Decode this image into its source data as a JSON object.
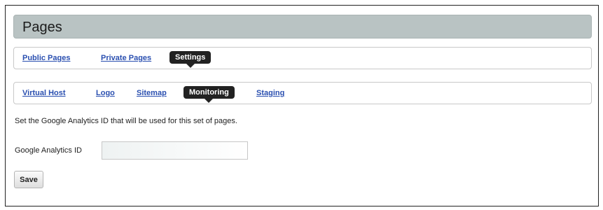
{
  "page": {
    "title": "Pages"
  },
  "primary_tabs": [
    {
      "label": "Public Pages",
      "active": false
    },
    {
      "label": "Private Pages",
      "active": false
    },
    {
      "label": "Settings",
      "active": true
    }
  ],
  "secondary_tabs": [
    {
      "label": "Virtual Host",
      "active": false
    },
    {
      "label": "Logo",
      "active": false
    },
    {
      "label": "Sitemap",
      "active": false
    },
    {
      "label": "Monitoring",
      "active": true
    },
    {
      "label": "Staging",
      "active": false
    }
  ],
  "monitoring": {
    "description": "Set the Google Analytics ID that will be used for this set of pages.",
    "field_label": "Google Analytics ID",
    "field_value": "",
    "save_label": "Save"
  },
  "colors": {
    "title_bar": "#b9c3c3",
    "link": "#2a4fb0",
    "active_tab": "#222222"
  }
}
